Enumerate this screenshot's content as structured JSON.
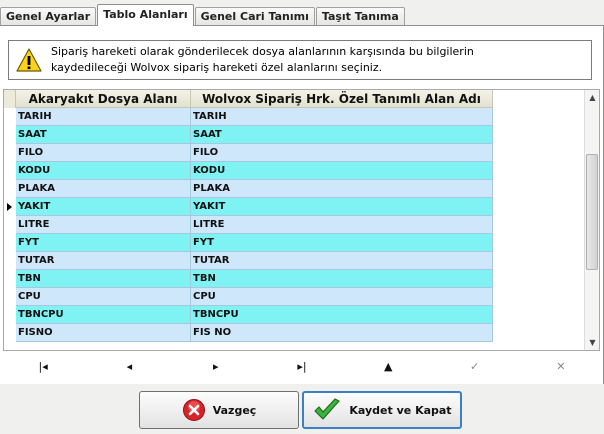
{
  "tabs": [
    {
      "label": "Genel Ayarlar",
      "active": false
    },
    {
      "label": "Tablo Alanları",
      "active": true
    },
    {
      "label": "Genel Cari Tanımı",
      "active": false
    },
    {
      "label": "Taşıt Tanıma",
      "active": false
    }
  ],
  "info": {
    "line1": "Sipariş hareketi olarak gönderilecek dosya alanlarının karşısında bu bilgilerin",
    "line2": "kaydedileceği Wolvox sipariş hareketi özel alanlarını seçiniz.",
    "icon": "warning-icon"
  },
  "grid": {
    "headers": [
      "Akaryakıt Dosya Alanı",
      "Wolvox Sipariş Hrk. Özel Tanımlı Alan Adı"
    ],
    "rows": [
      {
        "a": "TARIH",
        "b": "TARIH",
        "tint": "blue"
      },
      {
        "a": "SAAT",
        "b": "SAAT",
        "tint": "cyan"
      },
      {
        "a": "FILO",
        "b": "FILO",
        "tint": "blue"
      },
      {
        "a": "KODU",
        "b": "KODU",
        "tint": "cyan"
      },
      {
        "a": "PLAKA",
        "b": "PLAKA",
        "tint": "blue"
      },
      {
        "a": "YAKIT",
        "b": "YAKIT",
        "tint": "cyan",
        "current": true
      },
      {
        "a": "LITRE",
        "b": "LITRE",
        "tint": "blue"
      },
      {
        "a": "FYT",
        "b": "FYT",
        "tint": "cyan"
      },
      {
        "a": "TUTAR",
        "b": "TUTAR",
        "tint": "blue"
      },
      {
        "a": "TBN",
        "b": "TBN",
        "tint": "cyan"
      },
      {
        "a": "CPU",
        "b": "CPU",
        "tint": "blue"
      },
      {
        "a": "TBNCPU",
        "b": "TBNCPU",
        "tint": "cyan"
      },
      {
        "a": "FISNO",
        "b": "FIS NO",
        "tint": "blue"
      }
    ]
  },
  "navigator": [
    {
      "name": "first-record",
      "glyph": "|◂",
      "dim": false
    },
    {
      "name": "prior-record",
      "glyph": "◂",
      "dim": false
    },
    {
      "name": "next-record",
      "glyph": "▸",
      "dim": false
    },
    {
      "name": "last-record",
      "glyph": "▸|",
      "dim": false
    },
    {
      "name": "insert-record",
      "glyph": "▲",
      "dim": false
    },
    {
      "name": "post-record",
      "glyph": "✓",
      "dim": true
    },
    {
      "name": "cancel-record",
      "glyph": "✕",
      "dim": true
    }
  ],
  "buttons": {
    "cancel_label": "Vazgeç",
    "save_label": "Kaydet ve Kapat"
  },
  "colors": {
    "row_blue": "#cfe7fb",
    "row_cyan": "#7ff3f3",
    "accent": "#3b7fc4"
  }
}
